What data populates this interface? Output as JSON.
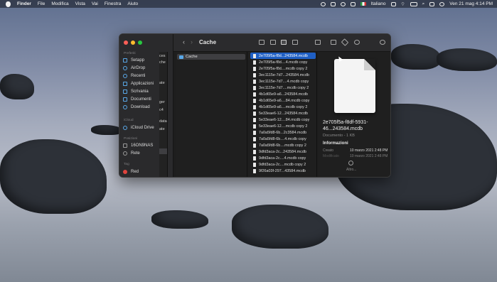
{
  "menubar": {
    "app_name": "Finder",
    "menus": [
      "File",
      "Modifica",
      "Vista",
      "Vai",
      "Finestra",
      "Aiuto"
    ],
    "language": "Italiano",
    "datetime": "Ven 21 mag  4:14 PM"
  },
  "window": {
    "title": "Cache",
    "sidebar": {
      "favorites_header": "Preferiti",
      "favorites": [
        "Setapp",
        "AirDrop",
        "Recenti",
        "Applicazioni",
        "Scrivania",
        "Documenti",
        "Download"
      ],
      "icloud_header": "iCloud",
      "icloud": [
        "iCloud Drive"
      ],
      "locations_header": "Posizioni",
      "locations": [
        "16ON9NAS",
        "Rete"
      ],
      "tags_header": "Tag",
      "tags": [
        "Red"
      ]
    },
    "column1": [
      "ces",
      "che",
      "ate",
      "ger",
      "c4",
      "data",
      "ate"
    ],
    "column2_selected": "Cache",
    "files": [
      "2e705f5a-f8d...243584.mcdb",
      "2e705f5a-f8d....4.mcdb copy",
      "2e705f5a-f8d....mcdb copy 2",
      "3ec1115e-7d7...243584.mcdb",
      "3ec1115e-7d7....4.mcdb copy",
      "3ec1115e-7d7....mcdb copy 2",
      "4b1d65e9-a6...243584.mcdb",
      "4b1d65e9-a6....84.mcdb copy",
      "4b1d65e9-a6....mcdb copy 2",
      "5e33eae6-12...243584.mcdb",
      "5e33eae6-12....84.mcdb copy",
      "5e33eae6-12....mcdb copy 2",
      "7a0a5fd8-6b...2c3584.mcdb",
      "7a0a5fd8-6b....4.mcdb copy",
      "7a0a5fd8-6b....mcdb copy 2",
      "9dfd3aca-2c...243584.mcdb",
      "9dfd3aca-2c....4.mcdb copy",
      "9dfd3aca-2c....mcdb copy 2",
      "9f26a03f-297...43584.mcdb"
    ],
    "preview": {
      "name": "2e705f5a-f8df-5931-46...243584.mcdb",
      "kind": "Documento - 1 KB",
      "info_header": "Informazioni",
      "created_label": "Creato",
      "created_value": "10 marzo 2021 2:48 PM",
      "modified_label": "Modificato",
      "modified_value": "10 marzo 2021 2:48 PM",
      "more_label": "Altro..."
    }
  },
  "colors": {
    "selection": "#1f5fc4",
    "folder": "#5aa8e8",
    "red_tag": "#e0443e"
  }
}
